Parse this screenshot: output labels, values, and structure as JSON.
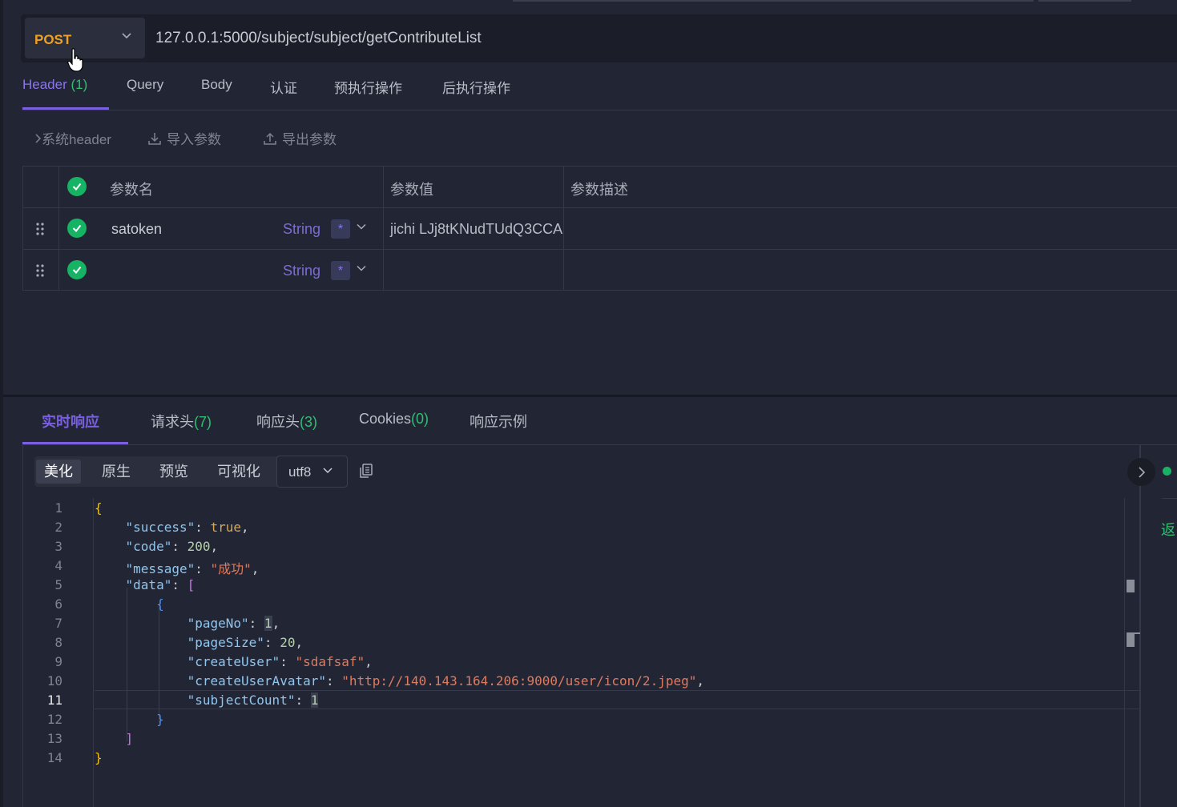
{
  "request": {
    "method": "POST",
    "url": "127.0.0.1:5000/subject/subject/getContributeList",
    "tabs": [
      {
        "label": "Header",
        "count": "(1)"
      },
      {
        "label": "Query",
        "count": ""
      },
      {
        "label": "Body",
        "count": ""
      },
      {
        "label": "认证",
        "count": ""
      },
      {
        "label": "预执行操作",
        "count": ""
      },
      {
        "label": "后执行操作",
        "count": ""
      }
    ],
    "tools": {
      "system_header": "系统header",
      "import": "导入参数",
      "export": "导出参数"
    },
    "table": {
      "headers": {
        "name": "参数名",
        "value": "参数值",
        "desc": "参数描述"
      },
      "rows": [
        {
          "name": "satoken",
          "type": "String",
          "required": "*",
          "value": "jichi LJj8tKNudTUdQ3CCA",
          "desc": ""
        },
        {
          "name": "",
          "type": "String",
          "required": "*",
          "value": "",
          "desc": ""
        }
      ]
    }
  },
  "response": {
    "tabs": [
      {
        "label": "实时响应",
        "count": ""
      },
      {
        "label": "请求头",
        "count": "(7)"
      },
      {
        "label": "响应头",
        "count": "(3)"
      },
      {
        "label": "Cookies",
        "count": "(0)"
      },
      {
        "label": "响应示例",
        "count": ""
      }
    ],
    "views": [
      "美化",
      "原生",
      "预览",
      "可视化"
    ],
    "encoding": "utf8",
    "side_text": "返"
  },
  "code": {
    "line_numbers": [
      "1",
      "2",
      "3",
      "4",
      "5",
      "6",
      "7",
      "8",
      "9",
      "10",
      "11",
      "12",
      "13",
      "14"
    ],
    "keys": {
      "success": "\"success\"",
      "code": "\"code\"",
      "message": "\"message\"",
      "data": "\"data\"",
      "pageNo": "\"pageNo\"",
      "pageSize": "\"pageSize\"",
      "createUser": "\"createUser\"",
      "createUserAvatar": "\"createUserAvatar\"",
      "subjectCount": "\"subjectCount\""
    },
    "values": {
      "success": "true",
      "code": "200",
      "message": "\"成功\"",
      "pageNo": "1",
      "pageSize": "20",
      "createUser": "\"sdafsaf\"",
      "createUserAvatar": "\"http://140.143.164.206:9000/user/icon/2.jpeg\"",
      "subjectCount": "1"
    }
  },
  "colors": {
    "accent": "#7a5fe0",
    "method": "#f0a020",
    "success": "#16b364",
    "count": "#2fbf71"
  }
}
